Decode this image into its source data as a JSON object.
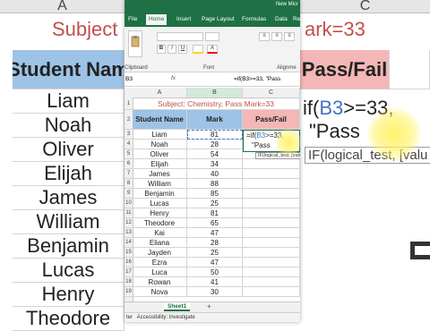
{
  "background": {
    "col_a": "A",
    "col_c": "C",
    "title_left": "Subject",
    "title_right": "ark=33",
    "header_left": "Student Nam",
    "header_right": "Pass/Fail",
    "names": [
      "Liam",
      "Noah",
      "Oliver",
      "Elijah",
      "James",
      "William",
      "Benjamin",
      "Lucas",
      "Henry",
      "Theodore"
    ],
    "formula_line1": "if(B3>=33,",
    "formula_b3": "B3",
    "formula_line2": "\"Pass",
    "tooltip": "IF(logical_test, [valu"
  },
  "window": {
    "title": "New Micr",
    "tabs": [
      "File",
      "Home",
      "Insert",
      "Page Layout",
      "Formulas",
      "Data",
      "Re"
    ],
    "active_tab": "Home",
    "groups": {
      "clipboard": "Clipboard",
      "font": "Font",
      "align": "Alignme"
    },
    "namebox": "B3",
    "formula": "=if(B3>=33, \"Pass",
    "columns": [
      "A",
      "B",
      "C"
    ],
    "sheet_title": "Subject: Chemistry, Pass Mark=33",
    "headers": {
      "name": "Student Name",
      "mark": "Mark",
      "result": "Pass/Fail"
    },
    "rows": [
      {
        "name": "Liam",
        "mark": "81"
      },
      {
        "name": "Noah",
        "mark": "28"
      },
      {
        "name": "Oliver",
        "mark": "54"
      },
      {
        "name": "Elijah",
        "mark": "34"
      },
      {
        "name": "James",
        "mark": "40"
      },
      {
        "name": "William",
        "mark": "88"
      },
      {
        "name": "Benjamin",
        "mark": "85"
      },
      {
        "name": "Lucas",
        "mark": "25"
      },
      {
        "name": "Henry",
        "mark": "81"
      },
      {
        "name": "Theodore",
        "mark": "65"
      },
      {
        "name": "Kai",
        "mark": "47"
      },
      {
        "name": "Eliana",
        "mark": "28"
      },
      {
        "name": "Jayden",
        "mark": "25"
      },
      {
        "name": "Ezra",
        "mark": "47"
      },
      {
        "name": "Luca",
        "mark": "50"
      },
      {
        "name": "Rowan",
        "mark": "41"
      },
      {
        "name": "Nova",
        "mark": "30"
      }
    ],
    "row_numbers": [
      "1",
      "2",
      "3",
      "4",
      "5",
      "6",
      "7",
      "8",
      "9",
      "10",
      "11",
      "12",
      "13",
      "14",
      "15",
      "16",
      "17",
      "18",
      "19"
    ],
    "editing_line1": "=if(",
    "editing_b3": "B3",
    "editing_line1_end": ">=33,",
    "editing_line2": "\"Pass",
    "tooltip": "IF(logical_test, [value",
    "sheet_tab": "Sheet1",
    "add_sheet": "+",
    "status": "ter   Accessibility: Investigate"
  },
  "colors": {
    "excel_green": "#1e7145",
    "title_red": "#c0504d",
    "header_blue": "#9dc3e6",
    "header_pink": "#f4b6b6",
    "ref_blue": "#4472c4"
  }
}
